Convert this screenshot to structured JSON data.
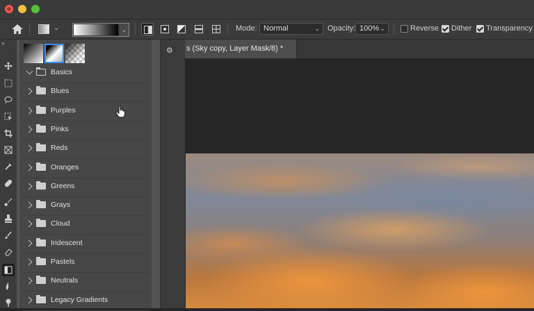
{
  "window": {
    "controls": [
      "close",
      "minimize",
      "maximize"
    ]
  },
  "options_bar": {
    "mode_label": "Mode:",
    "mode_value": "Normal",
    "opacity_label": "Opacity:",
    "opacity_value": "100%",
    "reverse_label": "Reverse",
    "reverse_checked": false,
    "dither_label": "Dither",
    "dither_checked": true,
    "transparency_label": "Transparency",
    "transparency_checked": true
  },
  "gradient_panel": {
    "presets": [
      "black-white",
      "foreground-transparent",
      "transparent"
    ],
    "folders": [
      {
        "label": "Basics",
        "open": true
      },
      {
        "label": "Blues",
        "open": false
      },
      {
        "label": "Purples",
        "open": false
      },
      {
        "label": "Pinks",
        "open": false
      },
      {
        "label": "Reds",
        "open": false
      },
      {
        "label": "Oranges",
        "open": false
      },
      {
        "label": "Greens",
        "open": false
      },
      {
        "label": "Grays",
        "open": false
      },
      {
        "label": "Cloud",
        "open": false
      },
      {
        "label": "Iridescent",
        "open": false
      },
      {
        "label": "Pastels",
        "open": false
      },
      {
        "label": "Neutrals",
        "open": false
      },
      {
        "label": "Legacy Gradients",
        "open": false
      }
    ]
  },
  "document": {
    "tab_title": "s (Sky copy, Layer Mask/8) *"
  },
  "colors": {
    "accent": "#3b8cff",
    "panel": "#474747",
    "canvas": "#262626"
  }
}
